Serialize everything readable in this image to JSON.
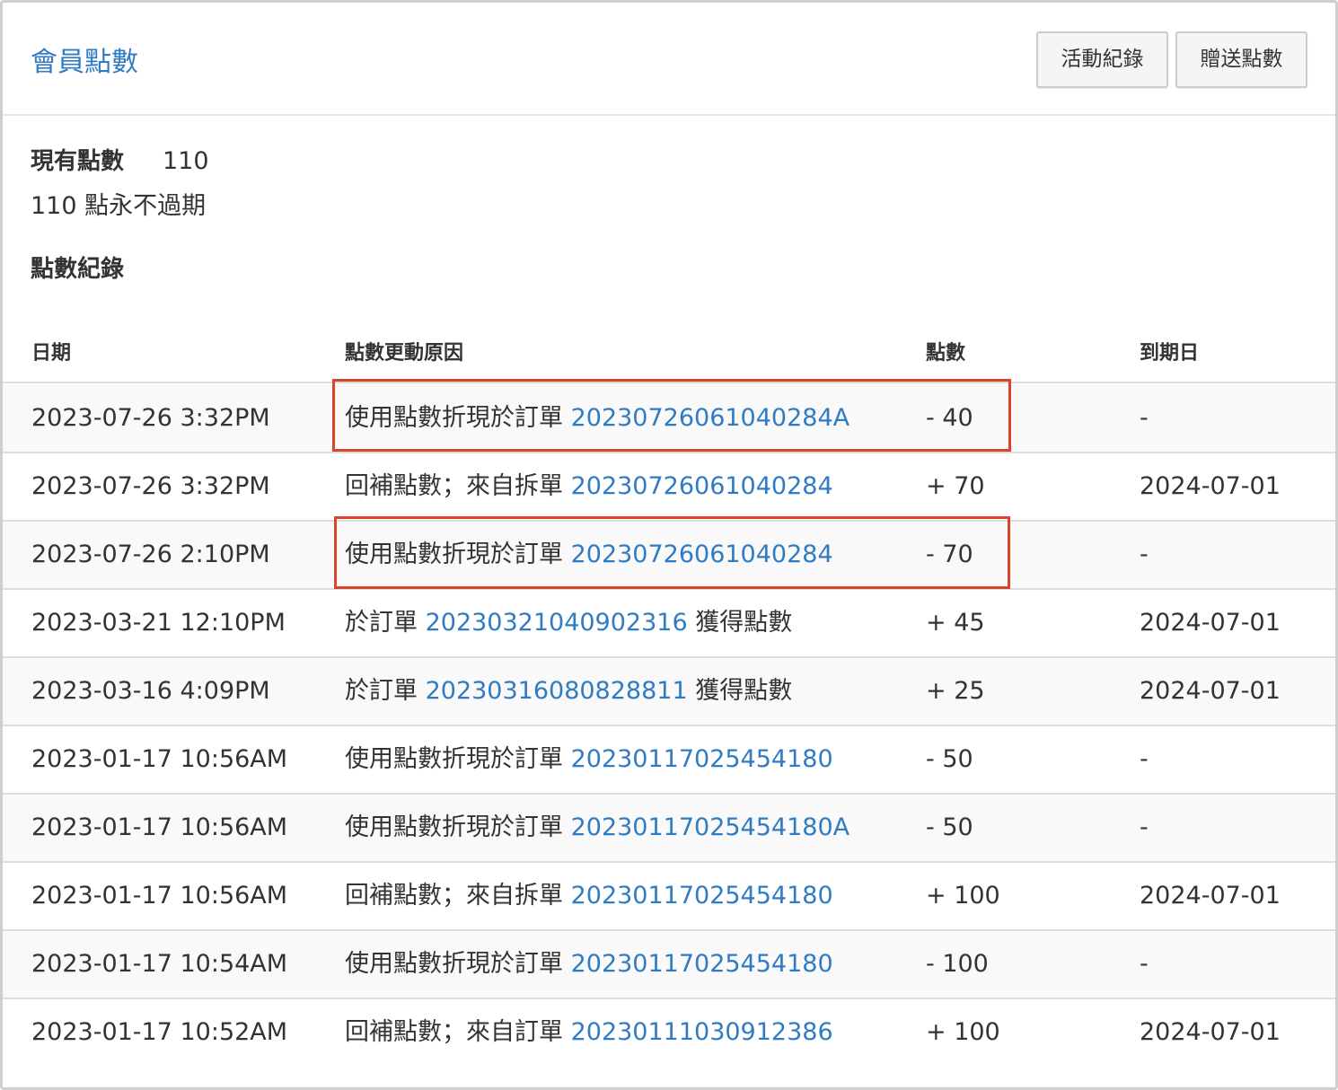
{
  "header": {
    "title": "會員點數",
    "buttons": {
      "history": "活動紀錄",
      "gift": "贈送點數"
    }
  },
  "summary": {
    "label": "現有點數",
    "value": "110",
    "expire_note": "110 點永不過期"
  },
  "records": {
    "section_title": "點數紀錄",
    "columns": {
      "date": "日期",
      "reason": "點數更動原因",
      "points": "點數",
      "expiry": "到期日"
    },
    "rows": [
      {
        "date": "2023-07-26 3:32PM",
        "reason_prefix": "使用點數折現於訂單 ",
        "order": "20230726061040284A",
        "reason_suffix": "",
        "points": "- 40",
        "expiry": "-",
        "highlighted": true
      },
      {
        "date": "2023-07-26 3:32PM",
        "reason_prefix": "回補點數；來自拆單 ",
        "order": "20230726061040284",
        "reason_suffix": "",
        "points": "+ 70",
        "expiry": "2024-07-01",
        "highlighted": false
      },
      {
        "date": "2023-07-26 2:10PM",
        "reason_prefix": "使用點數折現於訂單 ",
        "order": "20230726061040284",
        "reason_suffix": "",
        "points": "- 70",
        "expiry": "-",
        "highlighted": true
      },
      {
        "date": "2023-03-21 12:10PM",
        "reason_prefix": "於訂單 ",
        "order": "20230321040902316",
        "reason_suffix": " 獲得點數",
        "points": "+ 45",
        "expiry": "2024-07-01",
        "highlighted": false
      },
      {
        "date": "2023-03-16 4:09PM",
        "reason_prefix": "於訂單 ",
        "order": "20230316080828811",
        "reason_suffix": " 獲得點數",
        "points": "+ 25",
        "expiry": "2024-07-01",
        "highlighted": false
      },
      {
        "date": "2023-01-17 10:56AM",
        "reason_prefix": "使用點數折現於訂單 ",
        "order": "20230117025454180",
        "reason_suffix": "",
        "points": "- 50",
        "expiry": "-",
        "highlighted": false
      },
      {
        "date": "2023-01-17 10:56AM",
        "reason_prefix": "使用點數折現於訂單 ",
        "order": "20230117025454180A",
        "reason_suffix": "",
        "points": "- 50",
        "expiry": "-",
        "highlighted": false
      },
      {
        "date": "2023-01-17 10:56AM",
        "reason_prefix": "回補點數；來自拆單 ",
        "order": "20230117025454180",
        "reason_suffix": "",
        "points": "+ 100",
        "expiry": "2024-07-01",
        "highlighted": false
      },
      {
        "date": "2023-01-17 10:54AM",
        "reason_prefix": "使用點數折現於訂單 ",
        "order": "20230117025454180",
        "reason_suffix": "",
        "points": "- 100",
        "expiry": "-",
        "highlighted": false
      },
      {
        "date": "2023-01-17 10:52AM",
        "reason_prefix": "回補點數；來自訂單 ",
        "order": "20230111030912386",
        "reason_suffix": "",
        "points": "+ 100",
        "expiry": "2024-07-01",
        "highlighted": false
      }
    ]
  },
  "colors": {
    "link": "#2f7bc4",
    "highlight": "#d9452b",
    "stripe": "#f9f9f9"
  }
}
